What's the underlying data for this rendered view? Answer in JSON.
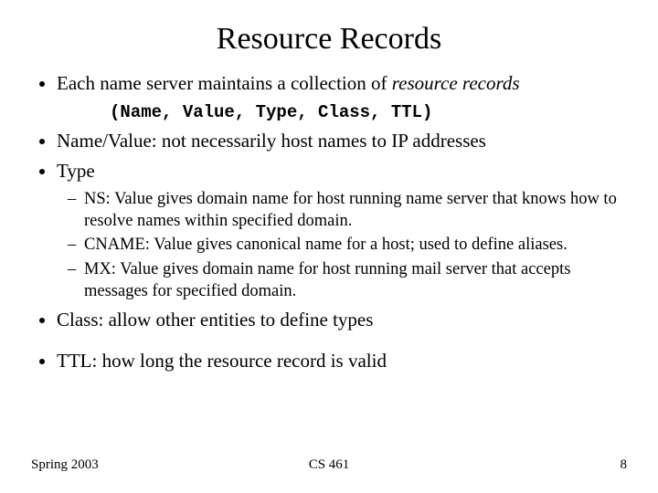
{
  "title": "Resource Records",
  "bullets": {
    "intro_prefix": "Each name server maintains a collection of ",
    "intro_italic": "resource records",
    "tuple": "(Name, Value, Type, Class, TTL)",
    "name_value": "Name/Value: not necessarily host names to IP addresses",
    "type_label": "Type",
    "types": {
      "ns": "NS: Value gives domain name for host running name server that knows how to resolve names within specified domain.",
      "cname": "CNAME: Value gives canonical name for a host; used to define aliases.",
      "mx": "MX: Value gives domain name for host running mail server that accepts messages for specified domain."
    },
    "class": "Class: allow other entities to define types",
    "ttl": "TTL: how long the resource record is valid"
  },
  "footer": {
    "left": "Spring 2003",
    "center": "CS 461",
    "right": "8"
  }
}
